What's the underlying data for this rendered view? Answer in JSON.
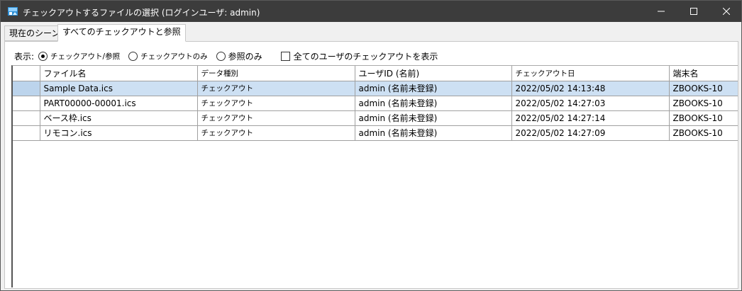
{
  "window": {
    "title": "チェックアウトするファイルの選択 (ログインユーザ: admin)",
    "minimize_glyph": "—",
    "maximize_glyph": "☐",
    "close_glyph": "✕"
  },
  "tabs": [
    {
      "label": "現在のシーン"
    },
    {
      "label": "すべてのチェックアウトと参照"
    }
  ],
  "filter": {
    "label": "表示:",
    "options": [
      {
        "label": "チェックアウト/参照",
        "checked": true
      },
      {
        "label": "チェックアウトのみ",
        "checked": false
      },
      {
        "label": "参照のみ",
        "checked": false
      }
    ],
    "show_all_users_label": "全てのユーザのチェックアウトを表示",
    "show_all_users_checked": false
  },
  "table": {
    "columns": [
      "ファイル名",
      "データ種別",
      "ユーザID (名前)",
      "チェックアウト日",
      "端末名"
    ],
    "rows": [
      {
        "file": "Sample Data.ics",
        "type": "チェックアウト",
        "user": "admin  (名前未登録)",
        "date": "2022/05/02 14:13:48",
        "machine": "ZBOOKS-10",
        "selected": true
      },
      {
        "file": "PART00000-00001.ics",
        "type": "チェックアウト",
        "user": "admin  (名前未登録)",
        "date": "2022/05/02 14:27:03",
        "machine": "ZBOOKS-10",
        "selected": false
      },
      {
        "file": "ベース枠.ics",
        "type": "チェックアウト",
        "user": "admin  (名前未登録)",
        "date": "2022/05/02 14:27:14",
        "machine": "ZBOOKS-10",
        "selected": false
      },
      {
        "file": "リモコン.ics",
        "type": "チェックアウト",
        "user": "admin  (名前未登録)",
        "date": "2022/05/02 14:27:09",
        "machine": "ZBOOKS-10",
        "selected": false
      }
    ]
  }
}
